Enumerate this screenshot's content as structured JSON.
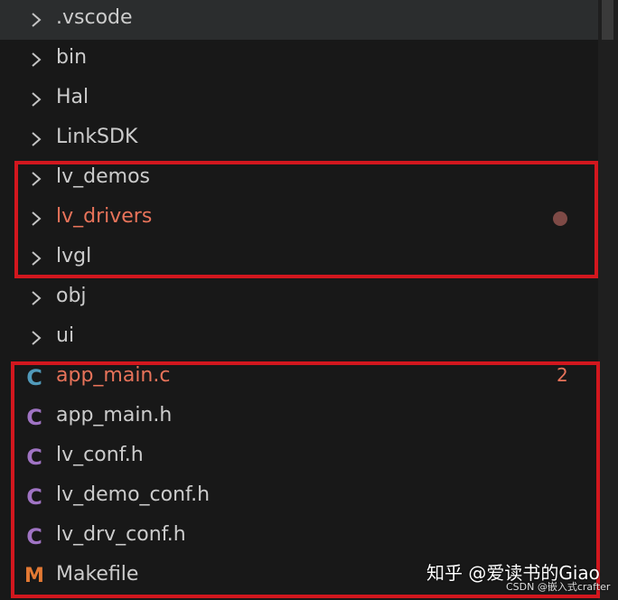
{
  "explorer": {
    "folders": [
      {
        "label": ".vscode"
      },
      {
        "label": "bin"
      },
      {
        "label": "Hal"
      },
      {
        "label": "LinkSDK"
      },
      {
        "label": "lv_demos"
      },
      {
        "label": "lv_drivers"
      },
      {
        "label": "lvgl"
      },
      {
        "label": "obj"
      },
      {
        "label": "ui"
      }
    ],
    "files": [
      {
        "label": "app_main.c",
        "icon": "C",
        "badge": "2"
      },
      {
        "label": "app_main.h",
        "icon": "C"
      },
      {
        "label": "lv_conf.h",
        "icon": "C"
      },
      {
        "label": "lv_demo_conf.h",
        "icon": "C"
      },
      {
        "label": "lv_drv_conf.h",
        "icon": "C"
      },
      {
        "label": "Makefile",
        "icon": "M"
      }
    ]
  },
  "colors": {
    "background": "#181818",
    "selected_row": "#2b2d2e",
    "modified_text": "#e8735a",
    "highlight_border": "#d2171e",
    "c_source_icon": "#519aba",
    "c_header_icon": "#a074c4",
    "makefile_icon": "#e37933"
  },
  "watermark": {
    "main": "知乎 @爱读书的Giao",
    "sub": "CSDN @嵌入式crafter"
  }
}
